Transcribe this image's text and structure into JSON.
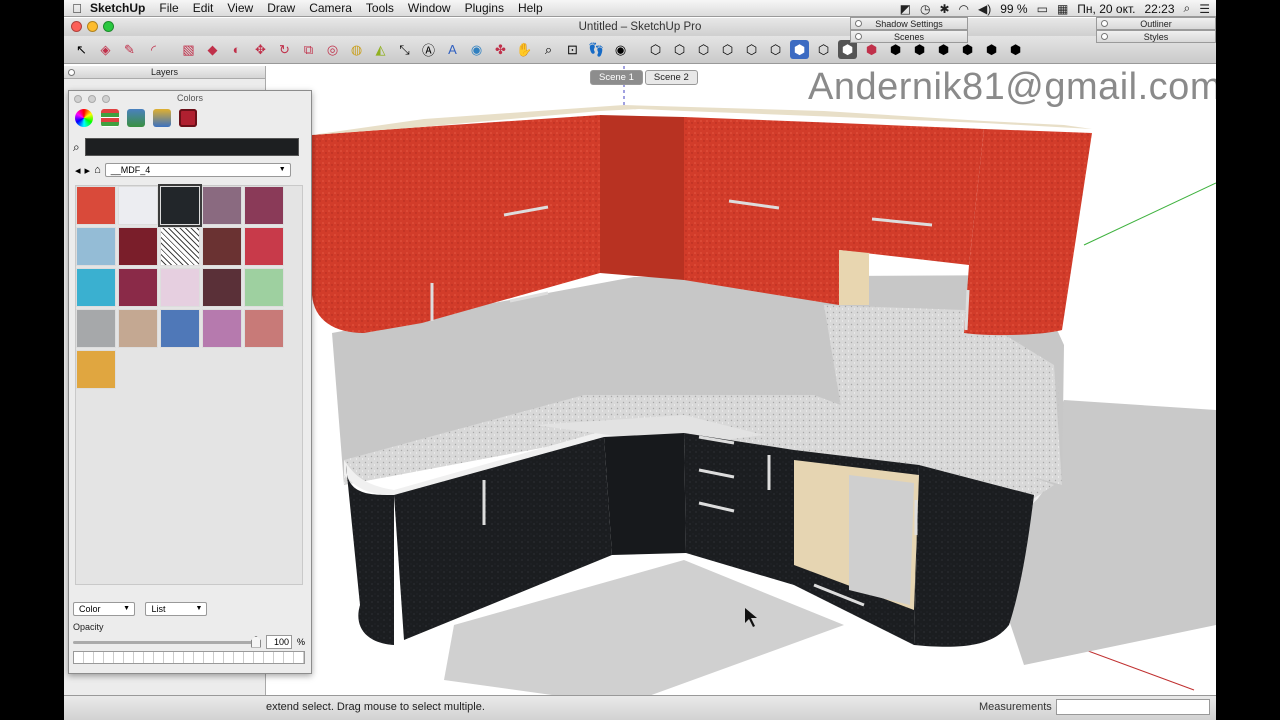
{
  "menubar": {
    "app": "SketchUp",
    "items": [
      "File",
      "Edit",
      "View",
      "Draw",
      "Camera",
      "Tools",
      "Window",
      "Plugins",
      "Help"
    ],
    "battery": "99 %",
    "date": "Пн, 20 окт.",
    "time": "22:23"
  },
  "window": {
    "title": "Untitled – SketchUp Pro"
  },
  "trays": {
    "shadow_settings": "Shadow Settings",
    "scenes": "Scenes",
    "outliner": "Outliner",
    "styles": "Styles"
  },
  "scene_tabs": [
    "Scene 1",
    "Scene 2"
  ],
  "watermark": "Andernik81@gmail.com",
  "layers_panel": {
    "title": "Layers"
  },
  "colors_panel": {
    "title": "Colors",
    "material": "__MDF_4",
    "mode_dropdown": "Color",
    "view_dropdown": "List",
    "opacity_label": "Opacity",
    "opacity_value": "100",
    "opacity_unit": "%",
    "opacity_fraction": 1.0,
    "swatches": [
      "#d94a3a",
      "#ecedf1",
      "#22262a",
      "#8a6a80",
      "#8a3a58",
      "#94bcd6",
      "#7a1e2a",
      "#pattern",
      "#6a3232",
      "#c83a4a",
      "#3ab0d0",
      "#8a2a48",
      "#e6cfe0",
      "#5a3038",
      "#9ed0a0",
      "#a6a8aa",
      "#c4a892",
      "#4f78b8",
      "#b67aae",
      "#c87a78",
      "#e0a640"
    ]
  },
  "status": {
    "text": "extend select. Drag mouse to select multiple.",
    "measurements_label": "Measurements"
  }
}
